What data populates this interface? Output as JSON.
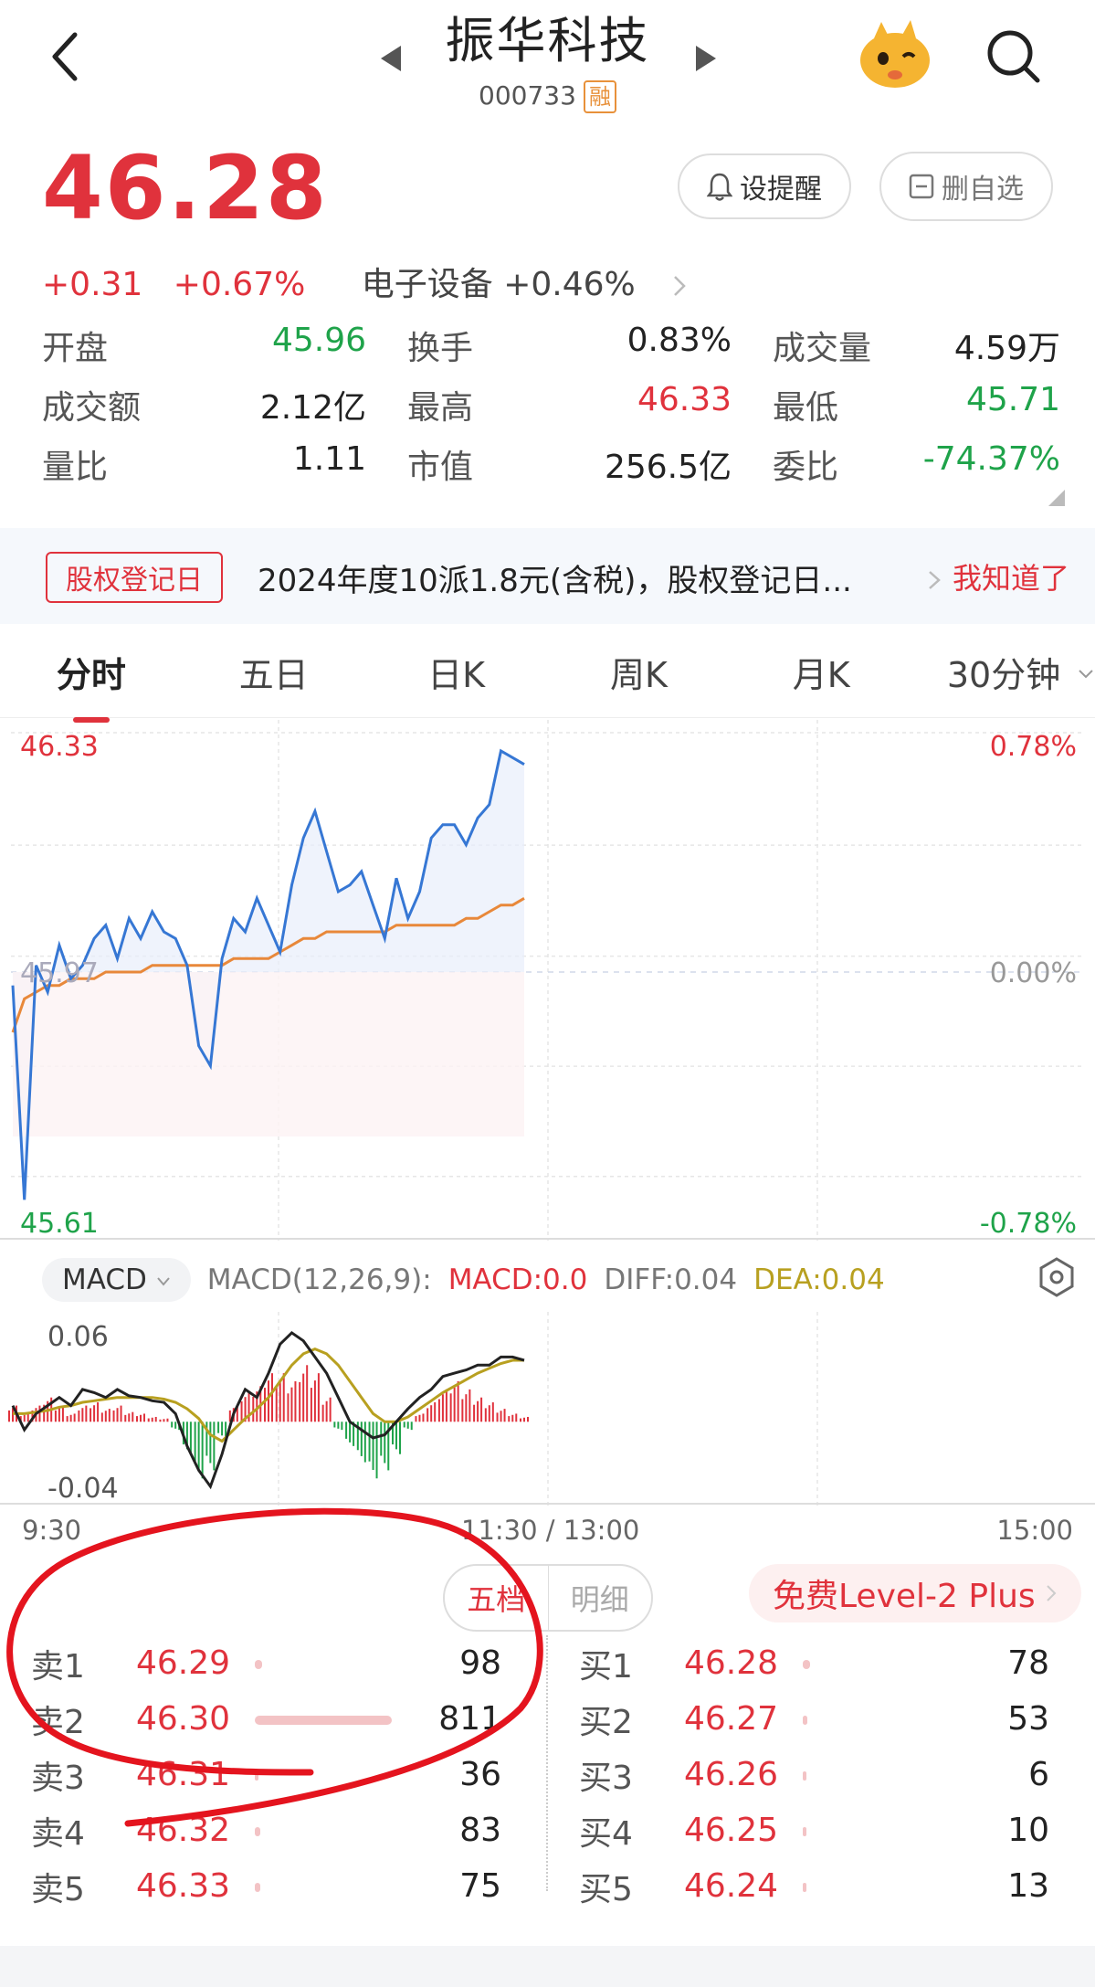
{
  "header": {
    "title": "振华科技",
    "code": "000733",
    "badge": "融"
  },
  "quote": {
    "price": "46.28",
    "change": "+0.31",
    "change_pct": "+0.67%",
    "sector": "电子设备 +0.46%",
    "alert_label": "设提醒",
    "remove_label": "删自选"
  },
  "stats": [
    [
      {
        "k": "开盘",
        "v": "45.96",
        "c": "green"
      },
      {
        "k": "换手",
        "v": "0.83%",
        "c": ""
      },
      {
        "k": "成交量",
        "v": "4.59万",
        "c": ""
      }
    ],
    [
      {
        "k": "成交额",
        "v": "2.12亿",
        "c": ""
      },
      {
        "k": "最高",
        "v": "46.33",
        "c": "red"
      },
      {
        "k": "最低",
        "v": "45.71",
        "c": "green"
      }
    ],
    [
      {
        "k": "量比",
        "v": "1.11",
        "c": ""
      },
      {
        "k": "市值",
        "v": "256.5亿",
        "c": ""
      },
      {
        "k": "委比",
        "v": "-74.37%",
        "c": "green"
      }
    ]
  ],
  "notice": {
    "tag": "股权登记日",
    "text": "2024年度10派1.8元(含税)，股权登记日...",
    "ok": "我知道了"
  },
  "tabs": [
    "分时",
    "五日",
    "日K",
    "周K",
    "月K",
    "30分钟"
  ],
  "chart_data": {
    "type": "line",
    "series": [
      {
        "values": [
          45.95,
          45.63,
          45.98,
          45.94,
          46.01,
          45.96,
          45.98,
          46.02,
          46.04,
          45.99,
          46.05,
          46.02,
          46.06,
          46.03,
          46.02,
          45.98,
          45.86,
          45.83,
          45.99,
          46.05,
          46.03,
          46.08,
          46.04,
          46.0,
          46.1,
          46.17,
          46.21,
          46.15,
          46.09,
          46.1,
          46.12,
          46.07,
          46.02,
          46.11,
          46.05,
          46.09,
          46.17,
          46.19,
          46.19,
          46.16,
          46.2,
          46.22,
          46.3,
          46.29,
          46.28
        ]
      },
      {
        "values": [
          45.88,
          45.93,
          45.94,
          45.95,
          45.95,
          45.96,
          45.96,
          45.96,
          45.97,
          45.97,
          45.97,
          45.97,
          45.98,
          45.98,
          45.98,
          45.98,
          45.98,
          45.98,
          45.98,
          45.99,
          45.99,
          45.99,
          45.99,
          46.0,
          46.01,
          46.02,
          46.02,
          46.03,
          46.03,
          46.03,
          46.03,
          46.03,
          46.03,
          46.04,
          46.04,
          46.04,
          46.04,
          46.04,
          46.04,
          46.05,
          46.05,
          46.06,
          46.07,
          46.07,
          46.08
        ]
      }
    ],
    "price_high": "46.33",
    "price_mid": "45.97",
    "price_low": "45.61",
    "pct_high": "0.78%",
    "pct_mid": "0.00%",
    "pct_low": "-0.78%",
    "ylim": [
      45.61,
      46.33
    ],
    "x_ticks": [
      "9:30",
      "11:30 / 13:00",
      "15:00"
    ]
  },
  "macd": {
    "selector": "MACD",
    "params": "MACD(12,26,9):",
    "macd": "MACD:0.0",
    "diff": "DIFF:0.04",
    "dea": "DEA:0.04",
    "ymax": "0.06",
    "ymin": "-0.04",
    "hist": [
      0.01,
      0.005,
      0.01,
      0.015,
      0.01,
      0.005,
      0.01,
      0.012,
      0.008,
      0.01,
      0.006,
      0.005,
      0.003,
      0.002,
      -0.005,
      -0.02,
      -0.035,
      -0.03,
      -0.01,
      0.01,
      0.018,
      0.022,
      0.03,
      0.03,
      0.025,
      0.035,
      0.03,
      0.015,
      -0.005,
      -0.015,
      -0.025,
      -0.035,
      -0.03,
      -0.02,
      -0.005,
      0.005,
      0.012,
      0.02,
      0.025,
      0.02,
      0.015,
      0.012,
      0.008,
      0.005,
      0.003
    ],
    "diff_line": [
      0.01,
      -0.005,
      0.005,
      0.01,
      0.015,
      0.01,
      0.02,
      0.018,
      0.015,
      0.02,
      0.016,
      0.015,
      0.013,
      0.012,
      0.005,
      -0.015,
      -0.03,
      -0.04,
      -0.02,
      0.005,
      0.02,
      0.015,
      0.03,
      0.048,
      0.055,
      0.05,
      0.04,
      0.03,
      0.015,
      0.0,
      -0.005,
      -0.01,
      -0.008,
      0.0,
      0.008,
      0.015,
      0.02,
      0.028,
      0.03,
      0.032,
      0.035,
      0.035,
      0.04,
      0.04,
      0.038
    ],
    "dea_line": [
      0.005,
      0.005,
      0.006,
      0.007,
      0.009,
      0.01,
      0.012,
      0.013,
      0.014,
      0.015,
      0.015,
      0.015,
      0.015,
      0.014,
      0.012,
      0.008,
      0.002,
      -0.008,
      -0.012,
      -0.005,
      0.002,
      0.008,
      0.015,
      0.025,
      0.035,
      0.042,
      0.045,
      0.042,
      0.035,
      0.025,
      0.015,
      0.005,
      0.0,
      0.0,
      0.003,
      0.008,
      0.013,
      0.018,
      0.022,
      0.026,
      0.03,
      0.033,
      0.036,
      0.038,
      0.038
    ]
  },
  "orderbook": {
    "tab_active": "五档",
    "tab_other": "明细",
    "level2": "免费Level-2 Plus",
    "sell": [
      {
        "n": "卖1",
        "p": "46.29",
        "v": "98",
        "w": 0.05
      },
      {
        "n": "卖2",
        "p": "46.30",
        "v": "811",
        "w": 1.0
      },
      {
        "n": "卖3",
        "p": "46.31",
        "v": "36",
        "w": 0.02
      },
      {
        "n": "卖4",
        "p": "46.32",
        "v": "83",
        "w": 0.04
      },
      {
        "n": "卖5",
        "p": "46.33",
        "v": "75",
        "w": 0.04
      }
    ],
    "buy": [
      {
        "n": "买1",
        "p": "46.28",
        "v": "78",
        "w": 0.05
      },
      {
        "n": "买2",
        "p": "46.27",
        "v": "53",
        "w": 0.03
      },
      {
        "n": "买3",
        "p": "46.26",
        "v": "6",
        "w": 0.01
      },
      {
        "n": "买4",
        "p": "46.25",
        "v": "10",
        "w": 0.01
      },
      {
        "n": "买5",
        "p": "46.24",
        "v": "13",
        "w": 0.01
      }
    ]
  }
}
